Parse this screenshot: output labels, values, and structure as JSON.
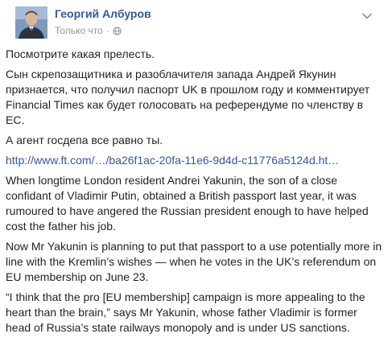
{
  "author": {
    "name": "Георгий Албуров",
    "time": "Только что",
    "separator": "·",
    "privacy_icon": "globe-icon"
  },
  "menu": {
    "icon": "chevron-down-icon"
  },
  "post": {
    "line1": "Посмотрите какая прелесть.",
    "line2": "Сын скрепозащитника и разоблачителя запада Андрей Якунин признается, что получил паспорт UK в прошлом году и комментирует Financial Times как будет голосовать на референдуме по членству в ЕС.",
    "line3": "А агент госдепа все равно ты.",
    "link": "http://www.ft.com/…/ba26f1ac-20fa-11e6-9d4d-c11776a5124d.ht…",
    "para1": "When longtime London resident Andrei Yakunin, the son of a close confidant of Vladimir Putin, obtained a British passport last year, it was rumoured to have angered the Russian president enough to have helped cost the father his job.",
    "para2": "Now Mr Yakunin is planning to put that passport to a use potentially more in line with the Kremlin’s wishes — when he votes in the UK’s referendum on EU membership on June 23.",
    "para3": "“I think that the pro [EU membership] campaign is more appealing to the heart than the brain,” says Mr Yakunin, whose father Vladimir is former head of Russia’s state railways monopoly and is under US sanctions."
  },
  "colors": {
    "link": "#365899",
    "text": "#1d2129",
    "meta": "#90949c"
  }
}
